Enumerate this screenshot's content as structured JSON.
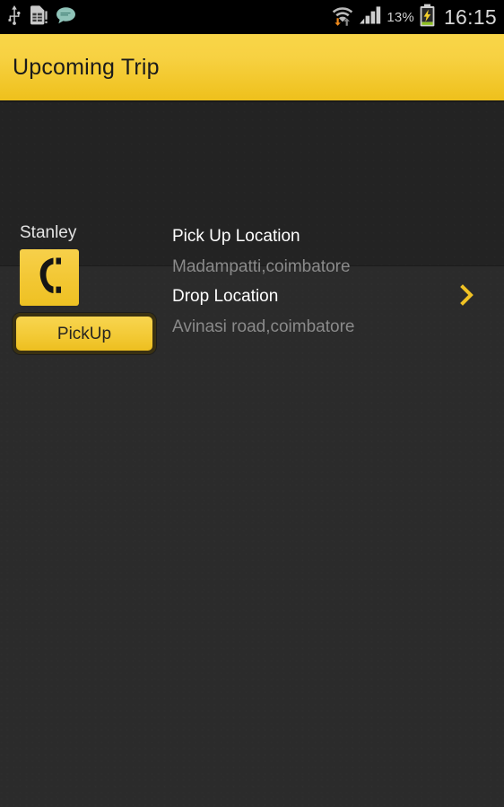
{
  "statusbar": {
    "left_icons": [
      {
        "name": "usb-icon",
        "label": "USB"
      },
      {
        "name": "sim-card-alert-icon",
        "label": "SIM card alert"
      },
      {
        "name": "message-bubble-icon",
        "label": "Messages"
      }
    ],
    "wifi_icon": "wifi-transfer-icon",
    "signal_icon": "cellular-signal-icon",
    "battery_percent": "13%",
    "battery_icon": "battery-charging-icon",
    "clock": "16:15"
  },
  "actionbar": {
    "title": "Upcoming Trip"
  },
  "trip": {
    "driver_name": "Stanley",
    "call_icon": "phone-handset-icon",
    "pickup_button_label": "PickUp",
    "pickup_location_label": "Pick Up Location",
    "pickup_location_value": "Madampatti,coimbatore",
    "drop_location_label": "Drop Location",
    "drop_location_value": "Avinasi road,coimbatore",
    "chevron_icon": "chevron-right-icon"
  },
  "colors": {
    "accent_yellow": "#f2c72a",
    "action_bar_top": "#f9d648",
    "action_bar_bottom": "#eec01c",
    "page_background": "#2b2b2b",
    "card_background": "#232323",
    "primary_text": "#ffffff",
    "secondary_text": "#8a8a8a",
    "status_bar_background": "#000000",
    "battery_fill_green": "#8ec01f",
    "wifi_down_arrow_orange": "#f08a1c"
  }
}
